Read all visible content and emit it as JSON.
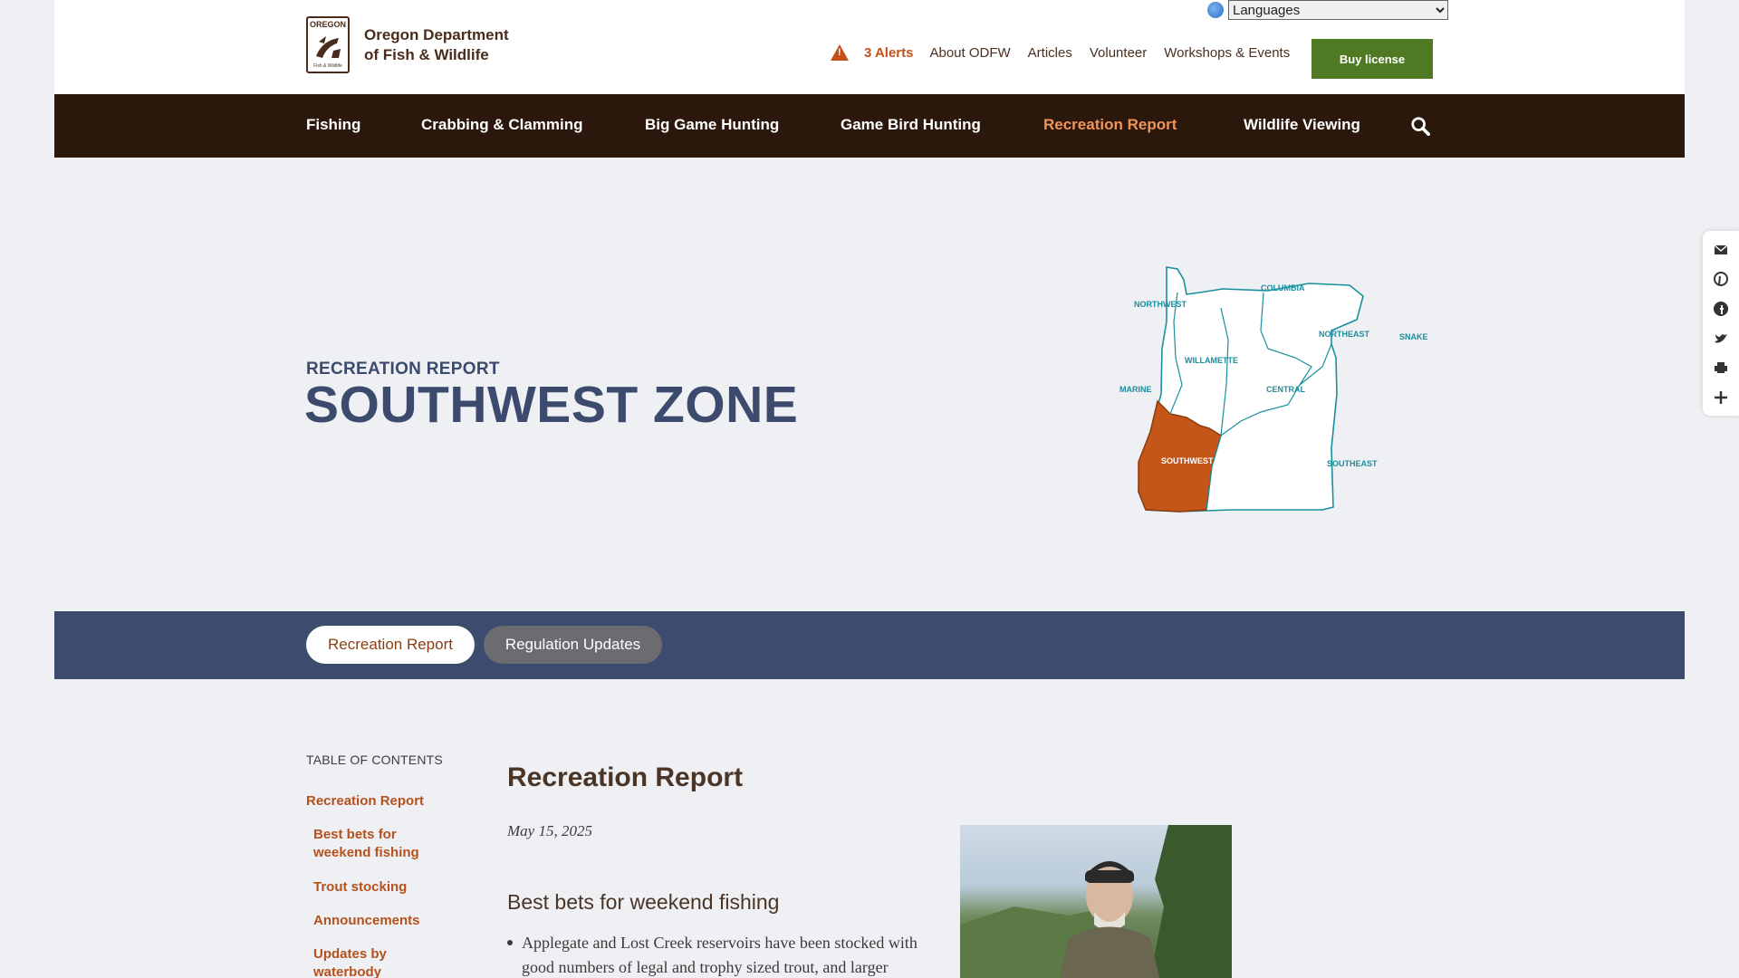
{
  "header": {
    "org_line1": "Oregon Department",
    "org_line2": "of Fish & Wildlife",
    "logo_top": "OREGON",
    "logo_bottom": "Fish & Wildlife",
    "language_select": "Languages",
    "alerts": "3 Alerts",
    "util_links": [
      "About ODFW",
      "Articles",
      "Volunteer",
      "Workshops & Events"
    ],
    "buy_license": "Buy license"
  },
  "nav": {
    "items": [
      "Fishing",
      "Crabbing & Clamming",
      "Big Game Hunting",
      "Game Bird Hunting",
      "Recreation Report",
      "Wildlife Viewing"
    ],
    "active": "Recreation Report"
  },
  "hero": {
    "kicker": "RECREATION REPORT",
    "title": "SOUTHWEST ZONE",
    "map_labels": [
      "NORTHWEST",
      "COLUMBIA",
      "NORTHEAST",
      "SNAKE",
      "WILLAMETTE",
      "MARINE",
      "CENTRAL",
      "SOUTHWEST",
      "SOUTHEAST"
    ],
    "highlight_color": "#c4561a"
  },
  "tabs": [
    {
      "label": "Recreation Report",
      "active": true
    },
    {
      "label": "Regulation Updates",
      "active": false
    }
  ],
  "toc": {
    "title": "TABLE OF CONTENTS",
    "main": "Recreation Report",
    "items": [
      "Best bets for weekend fishing",
      "Trout stocking",
      "Announcements",
      "Updates by waterbody"
    ]
  },
  "content": {
    "title": "Recreation Report",
    "date": "May 15, 2025",
    "section": "Best bets for weekend fishing",
    "bullet": "Applegate and Lost Creek reservoirs have been stocked with good numbers of legal and trophy sized trout, and larger"
  },
  "colors": {
    "nav_bg": "#2b170c",
    "accent_orange": "#c4511a",
    "navy": "#3d4c6e",
    "buy_green": "#4f7a23"
  }
}
